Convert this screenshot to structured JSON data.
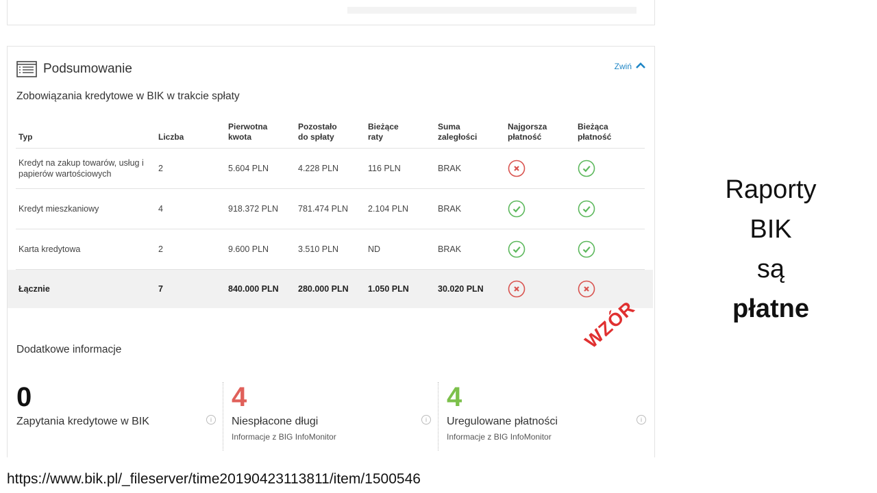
{
  "summary": {
    "title": "Podsumowanie",
    "collapse_label": "Zwiń",
    "subtitle": "Zobowiązania kredytowe w BIK w trakcie spłaty",
    "columns": [
      "Typ",
      "Liczba",
      "Pierwotna\nkwota",
      "Pozostało\ndo spłaty",
      "Bieżące\nraty",
      "Suma\nzaległości",
      "Najgorsza\npłatność",
      "Bieżąca\npłatność"
    ],
    "rows": [
      {
        "type": "Kredyt na zakup towarów, usług i papierów wartościowych",
        "count": "2",
        "original": "5.604 PLN",
        "remaining": "4.228 PLN",
        "installments": "116 PLN",
        "arrears": "BRAK",
        "worst": "bad",
        "current": "good"
      },
      {
        "type": "Kredyt mieszkaniowy",
        "count": "4",
        "original": "918.372 PLN",
        "remaining": "781.474 PLN",
        "installments": "2.104 PLN",
        "arrears": "BRAK",
        "worst": "good",
        "current": "good"
      },
      {
        "type": "Karta kredytowa",
        "count": "2",
        "original": "9.600 PLN",
        "remaining": "3.510 PLN",
        "installments": "ND",
        "arrears": "BRAK",
        "worst": "good",
        "current": "good"
      }
    ],
    "total": {
      "type": "Łącznie",
      "count": "7",
      "original": "840.000 PLN",
      "remaining": "280.000 PLN",
      "installments": "1.050 PLN",
      "arrears": "30.020 PLN",
      "worst": "bad",
      "current": "bad"
    }
  },
  "additional": {
    "title": "Dodatkowe informacje",
    "stats": [
      {
        "value": "0",
        "label": "Zapytania kredytowe w BIK",
        "sub": "",
        "color": "#111111"
      },
      {
        "value": "4",
        "label": "Niespłacone długi",
        "sub": "Informacje z BIG InfoMonitor",
        "color": "#e0605a"
      },
      {
        "value": "4",
        "label": "Uregulowane płatności",
        "sub": "Informacje z BIG InfoMonitor",
        "color": "#7cc04b"
      }
    ],
    "info_glyph": "i"
  },
  "watermark": "WZÓR",
  "side": {
    "line1": "Raporty",
    "line2": "BIK",
    "line3": "są",
    "line4": "płatne"
  },
  "source_url": "https://www.bik.pl/_fileserver/time20190423113811/item/1500546",
  "colors": {
    "accent": "#1f86c6",
    "good": "#5cb85c",
    "bad": "#d9534f"
  }
}
